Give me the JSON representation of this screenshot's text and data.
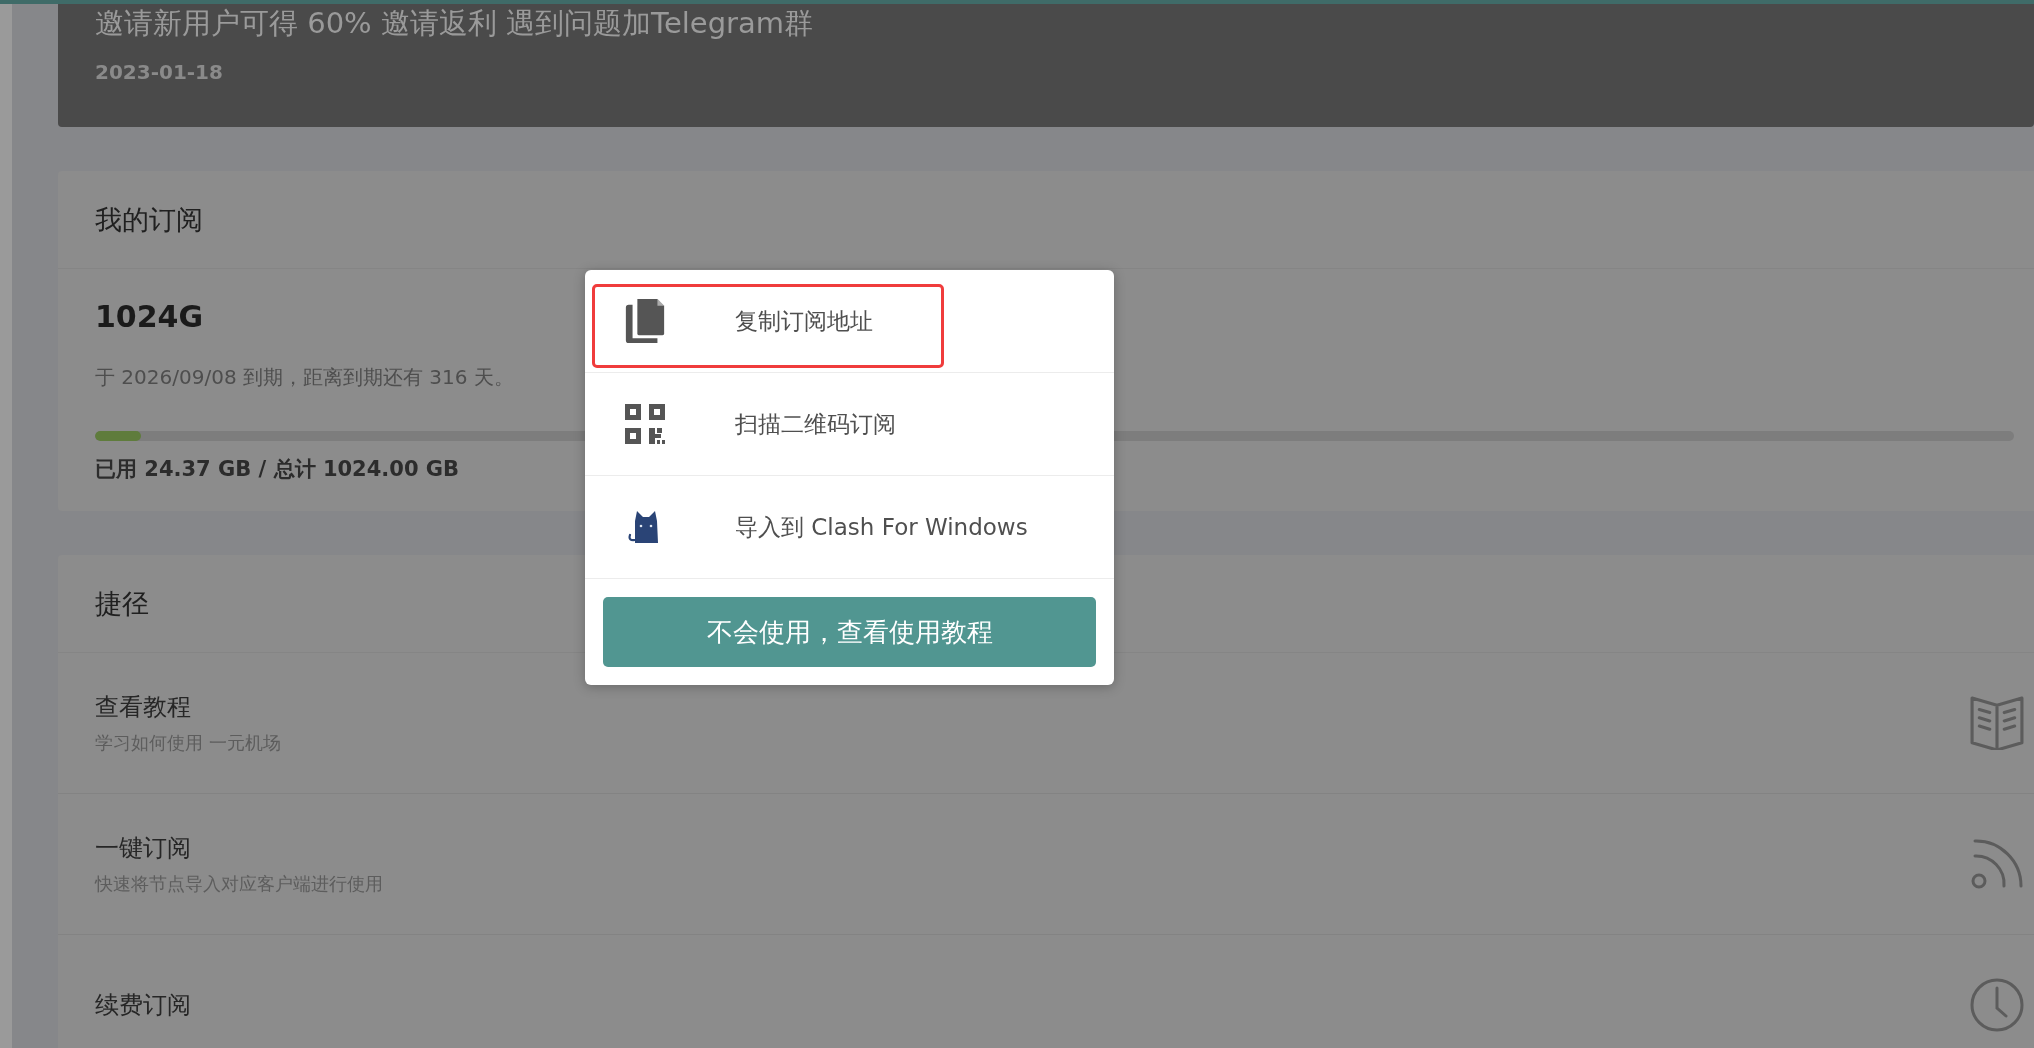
{
  "notice": {
    "title": "邀请新用户可得 60% 邀请返利 遇到问题加Telegram群",
    "date": "2023-01-18"
  },
  "subscription": {
    "heading": "我的订阅",
    "plan": "1024G",
    "expiry": "于 2026/09/08 到期，距离到期还有 316 天。",
    "level": 0.024,
    "usage": "已用 24.37 GB / 总计 1024.00 GB"
  },
  "shortcuts": {
    "heading": "捷径",
    "items": [
      {
        "kind": "book",
        "title": "查看教程",
        "subtitle": "学习如何使用 一元机场"
      },
      {
        "kind": "rss",
        "title": "一键订阅",
        "subtitle": "快速将节点导入对应客户端进行使用"
      },
      {
        "kind": "clock",
        "title": "续费订阅"
      }
    ]
  },
  "dialog": {
    "options": [
      {
        "kind": "copy",
        "label": "复制订阅地址",
        "highlighted": true
      },
      {
        "kind": "qr",
        "label": "扫描二维码订阅",
        "highlighted": false
      },
      {
        "kind": "cat",
        "label": "导入到 Clash For Windows",
        "highlighted": false
      }
    ],
    "help_button": "不会使用，查看使用教程"
  }
}
